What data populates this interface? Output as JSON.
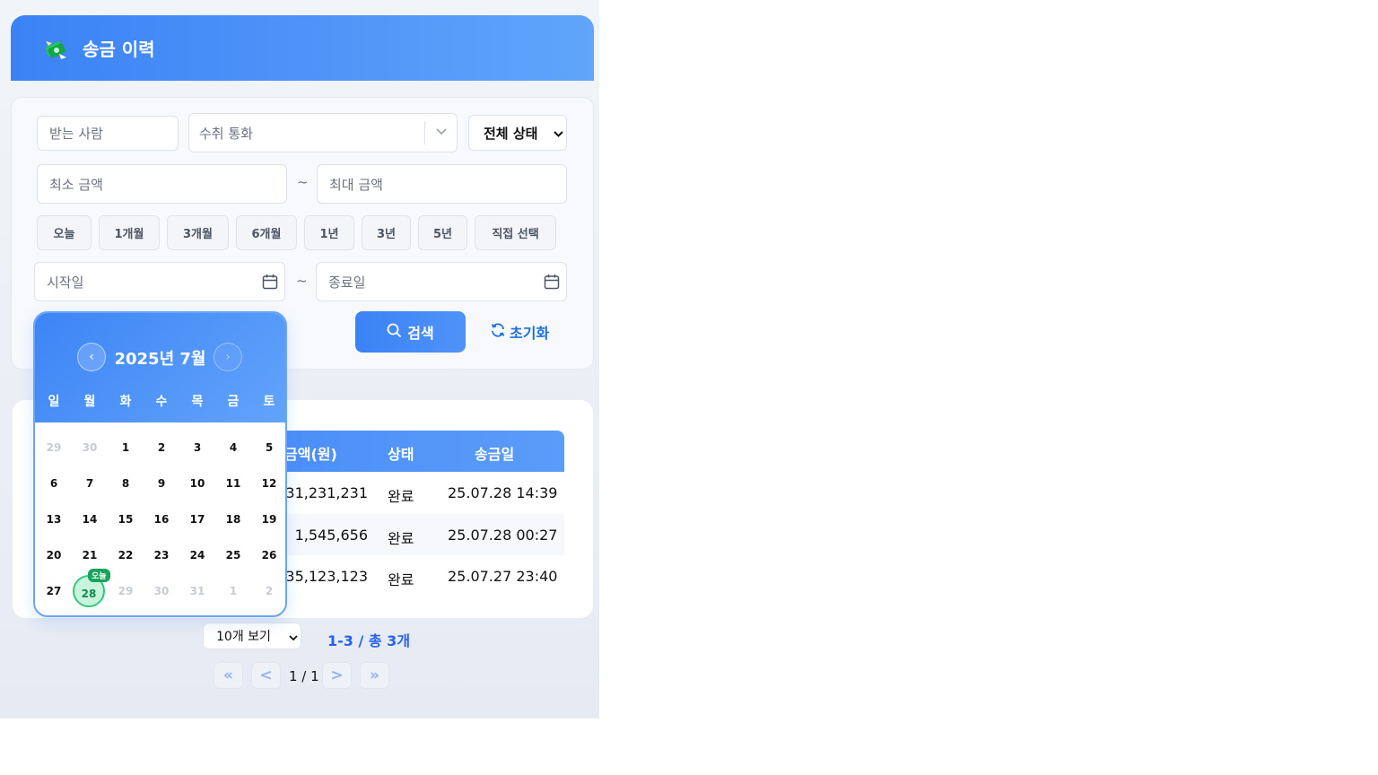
{
  "header": {
    "title": "송금 이력",
    "logo_icon": "money-transfer-icon"
  },
  "filters": {
    "recipient_placeholder": "받는 사람",
    "currency_placeholder": "수취 통화",
    "status_selected": "전체 상태",
    "min_amount_placeholder": "최소 금액",
    "max_amount_placeholder": "최대 금액",
    "range_sep": "~",
    "periods": [
      "오늘",
      "1개월",
      "3개월",
      "6개월",
      "1년",
      "3년",
      "5년",
      "직접 선택"
    ],
    "start_date_placeholder": "시작일",
    "end_date_placeholder": "종료일",
    "search_label": "검색",
    "reset_label": "초기화"
  },
  "calendar": {
    "title": "2025년 7월",
    "prev": "‹",
    "next": "›",
    "weekdays": [
      "일",
      "월",
      "화",
      "수",
      "목",
      "금",
      "토"
    ],
    "weeks": [
      [
        "29",
        "30",
        "1",
        "2",
        "3",
        "4",
        "5"
      ],
      [
        "6",
        "7",
        "8",
        "9",
        "10",
        "11",
        "12"
      ],
      [
        "13",
        "14",
        "15",
        "16",
        "17",
        "18",
        "19"
      ],
      [
        "20",
        "21",
        "22",
        "23",
        "24",
        "25",
        "26"
      ],
      [
        "27",
        "28",
        "29",
        "30",
        "31",
        "1",
        "2"
      ]
    ],
    "today_badge": "오늘",
    "today": "28"
  },
  "table": {
    "headers": {
      "amount": "금액(원)",
      "status": "상태",
      "date": "송금일"
    },
    "rows": [
      {
        "amount": "231,231,231",
        "status": "완료",
        "date": "25.07.28 14:39"
      },
      {
        "amount": "1,545,656",
        "status": "완료",
        "date": "25.07.28 00:27"
      },
      {
        "amount": "35,123,123",
        "status": "완료",
        "date": "25.07.27 23:40"
      }
    ]
  },
  "pagination": {
    "page_size": "10개 보기",
    "info": "1-3 / 총 3개",
    "first": "«",
    "prev": "<",
    "page": "1 / 1",
    "next": ">",
    "last": "»"
  },
  "colors": {
    "accent": "#3b82f6",
    "today": "#34c77b"
  }
}
